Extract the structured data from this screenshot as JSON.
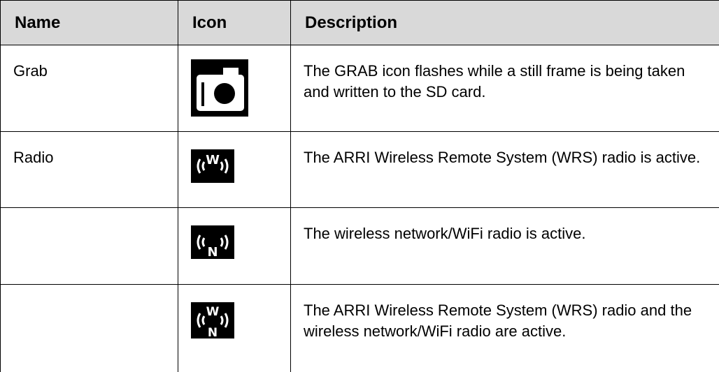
{
  "table": {
    "headers": {
      "name": "Name",
      "icon": "Icon",
      "description": "Description"
    },
    "rows": [
      {
        "name": "Grab",
        "icon": "camera-icon",
        "description": "The GRAB icon flashes while a still frame is being taken and written to the SD card."
      },
      {
        "name": "Radio",
        "icon": "wrs-radio-icon",
        "description": "The ARRI Wireless Remote System (WRS) radio is active."
      },
      {
        "name": "",
        "icon": "wifi-radio-icon",
        "description": "The wireless network/WiFi radio is active."
      },
      {
        "name": "",
        "icon": "wrs-and-wifi-radio-icon",
        "description": "The ARRI Wireless Remote System (WRS) radio and the wireless network/WiFi radio are active."
      }
    ]
  },
  "icons": {
    "wrs_letter": "W",
    "wifi_letter": "N"
  },
  "colors": {
    "header_background": "#d9d9d9",
    "border": "#000000",
    "icon_background": "#000000",
    "icon_foreground": "#ffffff"
  }
}
